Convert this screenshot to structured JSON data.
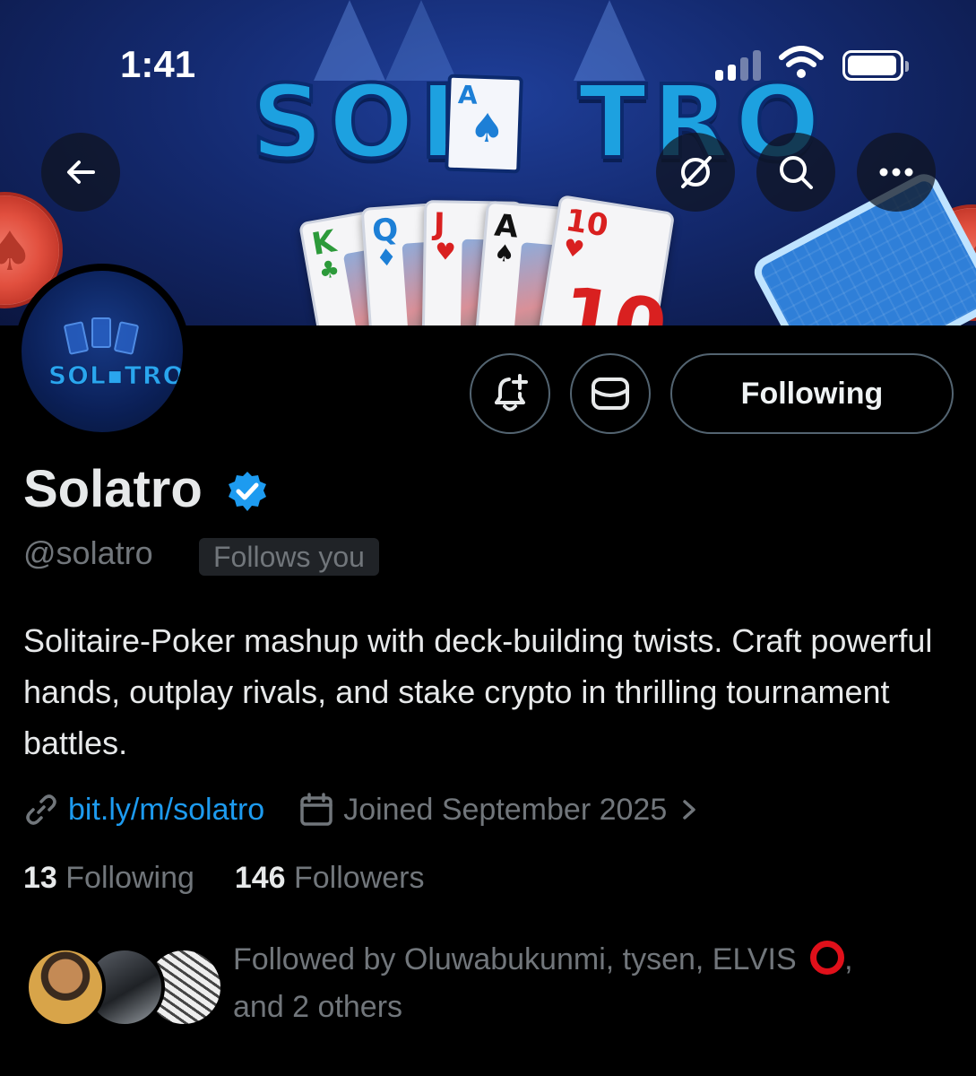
{
  "status_bar": {
    "time": "1:41"
  },
  "banner": {
    "title_left": "SOL",
    "title_right": "TRO",
    "title_card_rank": "A",
    "cards": [
      "K",
      "Q",
      "J",
      "A",
      "10"
    ],
    "card_big": "10"
  },
  "avatar": {
    "logo_text": "SOL▪TRO"
  },
  "actions": {
    "follow_label": "Following"
  },
  "profile": {
    "name": "Solatro",
    "handle": "@solatro",
    "follows_you": "Follows you",
    "bio": "Solitaire-Poker mashup with deck-building twists. Craft powerful hands, outplay rivals, and stake crypto in thrilling tournament battles.",
    "link": "bit.ly/m/solatro",
    "joined": "Joined September 2025",
    "following_count": "13",
    "following_label": "Following",
    "followers_count": "146",
    "followers_label": "Followers",
    "followed_by_text": "Followed by Oluwabukunmi, tysen, ELVIS",
    "followed_by_tail": ",",
    "followed_by_more": "and 2 others"
  },
  "colors": {
    "accent": "#1d9bf0",
    "muted": "#71767b",
    "text": "#e7e9ea",
    "border": "#536471"
  },
  "icons": [
    "back-arrow-icon",
    "grok-icon",
    "search-icon",
    "more-icon",
    "bell-plus-icon",
    "mail-icon",
    "verified-icon",
    "link-icon",
    "calendar-icon",
    "chevron-right-icon"
  ]
}
